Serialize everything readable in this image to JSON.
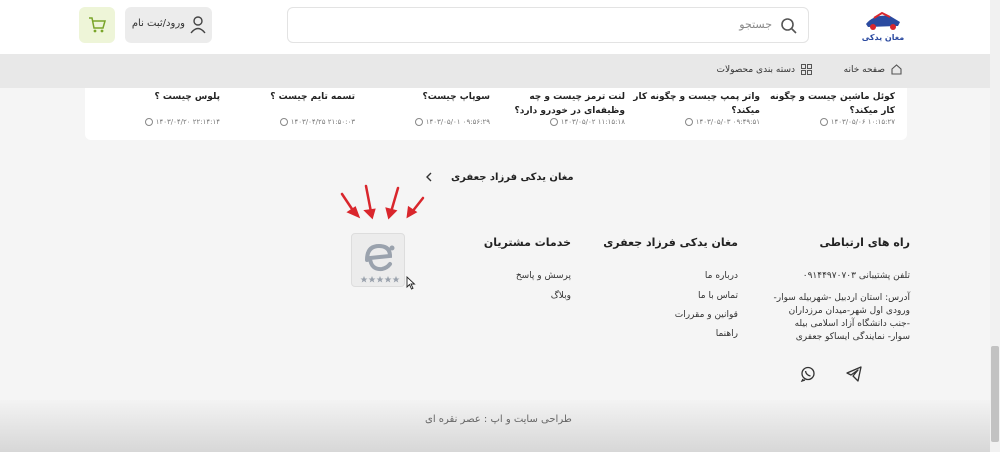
{
  "header": {
    "search_placeholder": "جستجو",
    "login_label": "ورود/ثبت نام",
    "logo_text": "مغان یدکی"
  },
  "nav": {
    "home": "صفحه خانه",
    "categories": "دسته بندی محصولات"
  },
  "articles": [
    {
      "title": "کوئل ماشین چیست و چگونه کار میکند؟",
      "date": "۱۴۰۳/۰۵/۰۶ ۱۰:۱۵:۲۷"
    },
    {
      "title": "واتر پمپ چیست و چگونه کار میکند؟",
      "date": "۱۴۰۳/۰۵/۰۳ ۰۹:۴۹:۵۱"
    },
    {
      "title": "لنت ترمز چیست و چه وظیفه‌ای در خودرو دارد؟",
      "date": "۱۴۰۳/۰۵/۰۲ ۱۱:۱۵:۱۸"
    },
    {
      "title": "سوپاپ چیست؟",
      "date": "۱۴۰۳/۰۵/۰۱ ۰۹:۵۶:۲۹"
    },
    {
      "title": "تسمه تایم چیست ؟",
      "date": "۱۴۰۳/۰۴/۲۵ ۲۱:۵۰:۰۳"
    },
    {
      "title": "پلوس چیست ؟",
      "date": "۱۴۰۳/۰۴/۲۰ ۲۲:۱۴:۱۴"
    }
  ],
  "footer": {
    "breadcrumb": "مغان یدکی فرزاد جعفری",
    "contact": {
      "title": "راه های ارتباطی",
      "phone": "تلفن پشتیبانی ۰۹۱۴۴۹۷۰۷۰۳",
      "address": "آدرس: استان اردبیل -شهربیله سوار- ورودی اول شهر-میدان مرزداران -جنب دانشگاه آزاد اسلامی بیله سوار- نمایندگی ایساکو جعفری"
    },
    "store": {
      "title": "مغان یدکی فرزاد جعفری",
      "links": [
        "درباره ما",
        "تماس با ما",
        "قوانین و مقررات",
        "راهنما"
      ]
    },
    "service": {
      "title": "خدمات مشتریان",
      "links": [
        "پرسش و پاسخ",
        "وبلاگ"
      ]
    },
    "bottom_text": "طراحی سایت و اپ : عصر نقره ای"
  },
  "colors": {
    "accent_red": "#d9262c",
    "cart_bg": "#eef5d8",
    "cart_icon": "#7aa52a"
  }
}
